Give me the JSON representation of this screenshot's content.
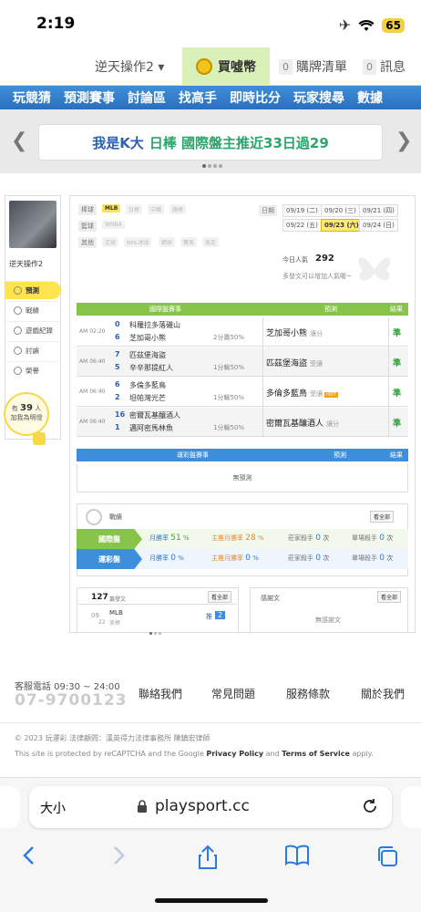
{
  "status": {
    "time": "2:19",
    "battery": "65",
    "airplane": "✈",
    "wifi": "wifi-icon"
  },
  "userbar": {
    "username": "逆天操作2 ▾",
    "buy_label": "買噓幣",
    "cart_count": "0",
    "cart_label": "購牌清單",
    "msg_count": "0",
    "msg_label": "訊息"
  },
  "nav": {
    "items": [
      "玩競猜",
      "預測賽事",
      "討論區",
      "找高手",
      "即時比分",
      "玩家搜尋",
      "數據"
    ]
  },
  "banner": {
    "text_a": "我是K大",
    "text_b": "日棒 國際盤主推近33日過29"
  },
  "profile": {
    "name": "逆天操作2",
    "menu": [
      "預測",
      "戰績",
      "遊戲紀錄",
      "討論",
      "榮譽"
    ],
    "fans_prefix": "有",
    "fans_count": "39",
    "fans_unit": "人",
    "fans_text": "加我為明燈"
  },
  "filters": {
    "baseball_label": "棒球",
    "basketball_label": "籃球",
    "other_label": "其他",
    "baseball_tags": [
      "MLB",
      "日棒",
      "中職",
      "韓棒"
    ],
    "basketball_tags": [
      "WNBA"
    ],
    "other_tags": [
      "足球",
      "NHL冰球",
      "網球",
      "賽馬",
      "美足"
    ],
    "date_label": "日期",
    "dates": [
      "09/19 (二)",
      "09/20 (三)",
      "09/21 (四)",
      "09/22 (五)",
      "09/23 (六)",
      "09/24 (日)"
    ]
  },
  "popularity": {
    "label": "今日人氣",
    "value": "292",
    "hint": "多發文可以增加人氣喔~"
  },
  "intl_table": {
    "header_game": "國際盤賽事",
    "header_pred": "預測",
    "header_result": "結果",
    "rows": [
      {
        "time": "AM 02:20",
        "n1": "0",
        "team1": "科羅拉多落磯山",
        "n2": "6",
        "team2": "芝加哥小熊",
        "odds": "2分贏50%",
        "pick": "芝加哥小熊",
        "side": "讓分",
        "hot": "",
        "result": "準"
      },
      {
        "time": "AM 06:40",
        "n1": "7",
        "team1": "匹茲堡海盜",
        "n2": "5",
        "team2": "辛辛那提紅人",
        "odds": "1分輸50%",
        "pick": "匹茲堡海盜",
        "side": "受讓",
        "hot": "",
        "result": "準"
      },
      {
        "time": "AM 06:40",
        "n1": "6",
        "team1": "多倫多藍鳥",
        "n2": "2",
        "team2": "坦帕灣光芒",
        "odds": "1分輸50%",
        "pick": "多倫多藍鳥",
        "side": "受讓",
        "hot": "HOT",
        "result": "準"
      },
      {
        "time": "AM 06:40",
        "n1": "16",
        "team1": "密爾瓦基釀酒人",
        "n2": "1",
        "team2": "邁阿密馬林魚",
        "odds": "1分輸50%",
        "pick": "密爾瓦基釀酒人",
        "side": "讓分",
        "hot": "",
        "result": "準"
      }
    ]
  },
  "tw_table": {
    "header_game": "運彩盤賽事",
    "header_pred": "預測",
    "header_result": "結果",
    "empty": "無預測"
  },
  "record": {
    "title": "戰績",
    "all_btn": "看全部",
    "intl_label": "國際盤",
    "tw_label": "運彩盤",
    "month_label": "月勝率",
    "main_label": "主推月勝率",
    "streak_label": "莊家殺手",
    "single_label": "單場殺手",
    "unit": "次",
    "intl": {
      "month": "51",
      "main": "28",
      "streak": "0",
      "single": "0"
    },
    "tw": {
      "month": "0",
      "main": "0",
      "streak": "0",
      "single": "0"
    }
  },
  "posts": {
    "count": "127",
    "label": "篇發文",
    "all_btn": "看全部",
    "date_m": "09",
    "date_d": "22",
    "league": "MLB",
    "post_title": "美棒",
    "push_label": "推",
    "push_count": "2"
  },
  "thanks": {
    "label": "感謝文",
    "all_btn": "看全部",
    "empty": "無感謝文"
  },
  "footer": {
    "service_label": "客服電話 09:30 ~ 24:00",
    "phone": "07-9700123",
    "links": [
      "聯絡我們",
      "常見問題",
      "服務條款",
      "關於我們"
    ],
    "copyright": "© 2023 玩運彩 法律顧問：漢英得力法律事務所 陳鎮宏律師",
    "recaptcha_a": "This site is protected by reCAPTCHA and the Google ",
    "privacy": "Privacy Policy",
    "and": " and ",
    "terms": "Terms of Service",
    "apply": " apply."
  },
  "browser": {
    "aa_label": "大小",
    "url": "playsport.cc"
  }
}
